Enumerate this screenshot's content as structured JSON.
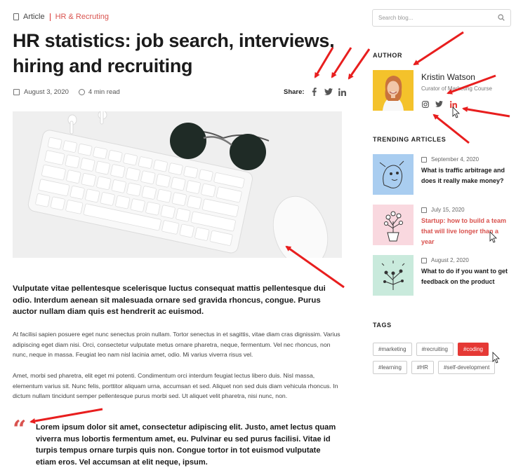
{
  "breadcrumb": {
    "type": "Article",
    "category": "HR & Recruting"
  },
  "article": {
    "title": "HR statistics: job search,  interviews, hiring and recruiting",
    "date": "August 3, 2020",
    "read_time": "4 min read",
    "share_label": "Share:",
    "share_icons": [
      "facebook-icon",
      "twitter-icon",
      "linkedin-icon"
    ],
    "lead": "Vulputate vitae pellentesque scelerisque luctus consequat mattis pellentesque dui odio. Interdum aenean sit malesuada ornare sed gravida rhoncus, congue. Purus auctor nullam diam quis est hendrerit ac euismod.",
    "paragraph1": "At facilisi sapien posuere eget nunc senectus proin nullam. Tortor senectus in et sagittis, vitae diam cras dignissim. Varius adipiscing eget diam nisi. Orci, consectetur vulputate metus ornare pharetra, neque, fermentum. Vel nec rhoncus, non nunc, neque in massa. Feugiat leo nam nisl lacinia amet, odio. Mi varius viverra risus vel.",
    "paragraph2": "Amet, morbi sed pharetra, elit eget mi potenti. Condimentum orci interdum feugiat lectus libero duis. Nisl massa, elementum varius sit. Nunc felis, porttitor aliquam urna, accumsan et sed. Aliquet non sed duis diam vehicula rhoncus. In dictum nullam tincidunt semper pellentesque purus morbi sed. Ut aliquet velit pharetra, nisi nunc, non.",
    "quote_mark": "“",
    "quote": "Lorem ipsum dolor sit amet, consectetur adipiscing elit. Justo, amet lectus quam viverra mus lobortis fermentum amet, eu. Pulvinar eu sed purus  facilisi. Vitae id turpis tempus ornare turpis quis non. Congue tortor in tot euismod vulputate etiam eros. Vel accumsan at elit neque, ipsum."
  },
  "sidebar": {
    "search_placeholder": "Search blog...",
    "author_heading": "AUTHOR",
    "author": {
      "name": "Kristin Watson",
      "role": "Curator of Marketing Course",
      "social_icons": [
        "instagram-icon",
        "twitter-icon",
        "linkedin-icon"
      ]
    },
    "trending_heading": "TRENDING ARTICLES",
    "trending": [
      {
        "date": "September 4, 2020",
        "title": "What is traffic arbitrage and does it really make money?",
        "thumb_color": "#a9cdf0"
      },
      {
        "date": "July 15, 2020",
        "title": "Startup: how to build a team that will live longer than a year",
        "thumb_color": "#f9d8df"
      },
      {
        "date": "August 2, 2020",
        "title": "What to do if you want to get feedback on the product",
        "thumb_color": "#c9eadc"
      }
    ],
    "tags_heading": "TAGS",
    "tags_row1": [
      "#marketing",
      "#recruiting",
      "#coding"
    ],
    "tags_row2": [
      "#learning",
      "#HR",
      "#self-development"
    ]
  },
  "colors": {
    "accent": "#d9534f",
    "tag_active": "#e53935",
    "arrow": "#e81e1e"
  }
}
